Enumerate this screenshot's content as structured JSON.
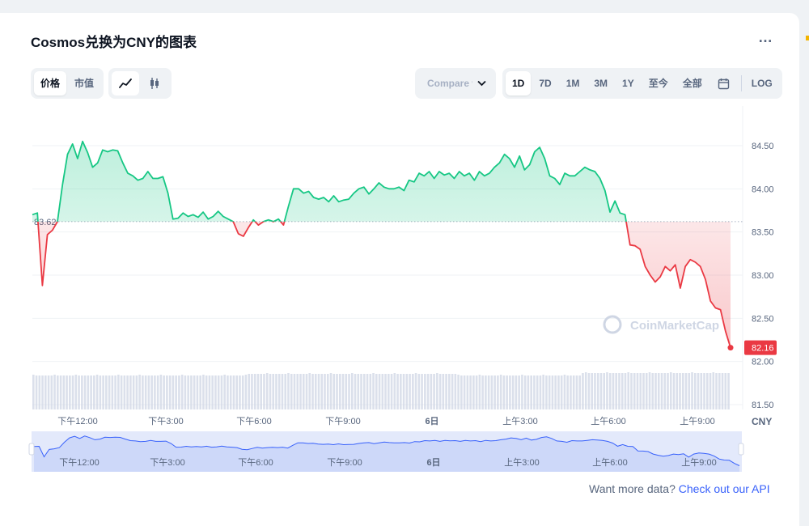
{
  "title": "Cosmos兑换为CNY的图表",
  "more_icon": "more-horizontal-icon",
  "toggles": {
    "price_label": "价格",
    "marketcap_label": "市值"
  },
  "compare": {
    "label": "Compare with"
  },
  "ranges": [
    "1D",
    "7D",
    "1M",
    "3M",
    "1Y",
    "至今",
    "全部"
  ],
  "log_label": "LOG",
  "watermark": "CoinMarketCap",
  "currency_label": "CNY",
  "api_note": {
    "text": "Want more data?",
    "link": "Check out our API"
  },
  "colors": {
    "up": "#16c784",
    "down": "#ea3943",
    "brand": "#3861fb",
    "grid": "#eff2f5"
  },
  "chart_data": {
    "type": "line",
    "title": "",
    "ylim": [
      81.5,
      84.75
    ],
    "yticks": [
      "84.50",
      "84.00",
      "83.50",
      "83.00",
      "82.50",
      "82.00",
      "81.50"
    ],
    "xticks": [
      "下午12:00",
      "下午3:00",
      "下午6:00",
      "下午9:00",
      "6日",
      "上午3:00",
      "上午6:00",
      "上午9:00"
    ],
    "baseline": 83.62,
    "baseline_label": "83.62",
    "last_price": 82.16,
    "last_label": "82.16",
    "y": [
      83.7,
      83.72,
      82.88,
      83.47,
      83.52,
      83.62,
      84.05,
      84.4,
      84.52,
      84.35,
      84.55,
      84.42,
      84.25,
      84.3,
      84.45,
      84.43,
      84.45,
      84.44,
      84.3,
      84.18,
      84.15,
      84.1,
      84.12,
      84.2,
      84.12,
      84.12,
      84.14,
      83.95,
      83.65,
      83.66,
      83.72,
      83.68,
      83.7,
      83.67,
      83.73,
      83.65,
      83.68,
      83.74,
      83.68,
      83.65,
      83.62,
      83.48,
      83.45,
      83.55,
      83.64,
      83.58,
      83.62,
      83.64,
      83.62,
      83.65,
      83.58,
      83.8,
      84.0,
      84.0,
      83.95,
      83.97,
      83.9,
      83.88,
      83.9,
      83.85,
      83.92,
      83.85,
      83.87,
      83.88,
      83.95,
      84.0,
      84.02,
      83.94,
      84.0,
      84.07,
      84.02,
      84.0,
      84.0,
      84.02,
      83.98,
      84.1,
      84.08,
      84.18,
      84.15,
      84.2,
      84.12,
      84.2,
      84.16,
      84.18,
      84.12,
      84.2,
      84.15,
      84.18,
      84.1,
      84.2,
      84.15,
      84.18,
      84.25,
      84.3,
      84.4,
      84.35,
      84.25,
      84.38,
      84.22,
      84.28,
      84.43,
      84.48,
      84.35,
      84.15,
      84.12,
      84.05,
      84.18,
      84.15,
      84.15,
      84.2,
      84.25,
      84.22,
      84.2,
      84.12,
      83.98,
      83.73,
      83.86,
      83.72,
      83.7,
      83.35,
      83.34,
      83.3,
      83.1,
      83.0,
      82.92,
      82.98,
      83.1,
      83.05,
      83.12,
      82.85,
      83.1,
      83.18,
      83.15,
      83.1,
      82.95,
      82.7,
      82.62,
      82.6,
      82.35,
      82.16
    ]
  }
}
